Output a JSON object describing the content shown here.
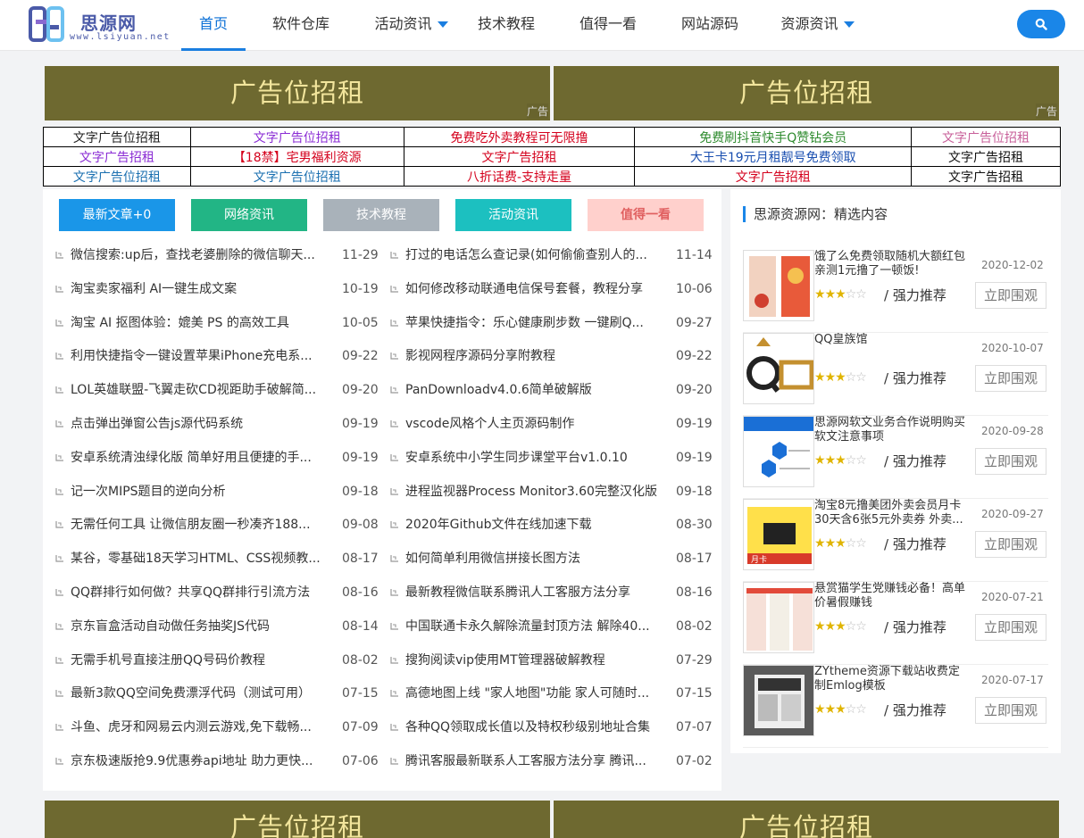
{
  "header": {
    "logo_title": "思源网",
    "logo_url": "www.lsiyuan.net",
    "nav": [
      {
        "label": "首页",
        "active": true,
        "dropdown": false
      },
      {
        "label": "软件仓库",
        "active": false,
        "dropdown": false
      },
      {
        "label": "活动资讯",
        "active": false,
        "dropdown": true
      },
      {
        "label": "技术教程",
        "active": false,
        "dropdown": false
      },
      {
        "label": "值得一看",
        "active": false,
        "dropdown": false
      },
      {
        "label": "网站源码",
        "active": false,
        "dropdown": false
      },
      {
        "label": "资源资讯",
        "active": false,
        "dropdown": true
      }
    ],
    "search_icon": "search-icon"
  },
  "ads": {
    "banner_text": "广告位招租",
    "banner_tag": "广告",
    "banner_color": "#6e6930",
    "text_ads": [
      [
        {
          "text": "文字广告位招租",
          "color": "#222222"
        },
        {
          "text": "文字广告位招租",
          "color": "#8a2bd4"
        },
        {
          "text": "免费吃外卖教程可无限撸",
          "color": "#d4001c"
        },
        {
          "text": "免费刷抖音快手Q赞钻会员",
          "color": "#2e8b2e"
        },
        {
          "text": "文字广告位招租",
          "color": "#c8609a"
        }
      ],
      [
        {
          "text": "文字广告招租",
          "color": "#8a2bd4"
        },
        {
          "text": "【18禁】宅男福利资源",
          "color": "#d4001c"
        },
        {
          "text": "文字广告招租",
          "color": "#d4001c"
        },
        {
          "text": "大王卡19元月租靓号免费领取",
          "color": "#1a4fb0"
        },
        {
          "text": "文字广告招租",
          "color": "#111111"
        }
      ],
      [
        {
          "text": "文字广告位招租",
          "color": "#1a6fb0"
        },
        {
          "text": "文字广告位招租",
          "color": "#1a6fb0"
        },
        {
          "text": "八折话费-支持走量",
          "color": "#d4001c"
        },
        {
          "text": "文字广告招租",
          "color": "#d4001c"
        },
        {
          "text": "文字广告招租",
          "color": "#111111"
        }
      ]
    ]
  },
  "main": {
    "tabs": [
      {
        "label": "最新文章+0",
        "color": "#1a96e8"
      },
      {
        "label": "网络资讯",
        "color": "#22b585"
      },
      {
        "label": "技术教程",
        "color": "#a9b2ba"
      },
      {
        "label": "活动资讯",
        "color": "#1cc0c0"
      },
      {
        "label": "值得一看",
        "color": "#ffd0cc"
      }
    ],
    "left_posts": [
      {
        "title": "微信搜索:up后，查找老婆删除的微信聊天...",
        "date": "11-29"
      },
      {
        "title": "淘宝卖家福利 AI一键生成文案",
        "date": "10-19"
      },
      {
        "title": "淘宝 AI 抠图体验：媲美 PS 的高效工具",
        "date": "10-05"
      },
      {
        "title": "利用快捷指令一键设置苹果iPhone充电系...",
        "date": "09-22"
      },
      {
        "title": "LOL英雄联盟-飞翼走砍CD视距助手破解简...",
        "date": "09-20"
      },
      {
        "title": "点击弹出弹窗公告js源代码系统",
        "date": "09-19"
      },
      {
        "title": "安卓系统清浊绿化版 简单好用且便捷的手...",
        "date": "09-19"
      },
      {
        "title": "记一次MIPS题目的逆向分析",
        "date": "09-18"
      },
      {
        "title": "无需任何工具 让微信朋友圈一秒凑齐188...",
        "date": "09-08"
      },
      {
        "title": "某谷，零基础18天学习HTML、CSS视频教...",
        "date": "08-17"
      },
      {
        "title": "QQ群排行如何做？共享QQ群排行引流方法",
        "date": "08-16"
      },
      {
        "title": "京东盲盒活动自动做任务抽奖JS代码",
        "date": "08-14"
      },
      {
        "title": "无需手机号直接注册QQ号码价教程",
        "date": "08-02"
      },
      {
        "title": "最新3款QQ空间免费漂浮代码（测试可用）",
        "date": "07-15"
      },
      {
        "title": "斗鱼、虎牙和网易云内测云游戏,免下载畅...",
        "date": "07-09"
      },
      {
        "title": "京东极速版抢9.9优惠券api地址 助力更快...",
        "date": "07-06"
      }
    ],
    "right_posts": [
      {
        "title": "打过的电话怎么查记录(如何偷偷查别人的...",
        "date": "11-14"
      },
      {
        "title": "如何修改移动联通电信保号套餐，教程分享",
        "date": "10-06"
      },
      {
        "title": "苹果快捷指令：乐心健康刷步数 一键刷Q...",
        "date": "09-27"
      },
      {
        "title": "影视网程序源码分享附教程",
        "date": "09-22"
      },
      {
        "title": "PanDownloadv4.0.6简单破解版",
        "date": "09-20"
      },
      {
        "title": "vscode风格个人主页源码制作",
        "date": "09-19"
      },
      {
        "title": "安卓系统中小学生同步课堂平台v1.0.10",
        "date": "09-19"
      },
      {
        "title": "进程监视器Process Monitor3.60完整汉化版",
        "date": "09-18"
      },
      {
        "title": "2020年Github文件在线加速下载",
        "date": "08-30"
      },
      {
        "title": "如何简单利用微信拼接长图方法",
        "date": "08-17"
      },
      {
        "title": "最新教程微信联系腾讯人工客服方法分享",
        "date": "08-16"
      },
      {
        "title": "中国联通卡永久解除流量封顶方法 解除40...",
        "date": "08-02"
      },
      {
        "title": "搜狗阅读vip使用MT管理器破解教程",
        "date": "07-29"
      },
      {
        "title": "高德地图上线 \"家人地图\"功能 家人可随时...",
        "date": "07-15"
      },
      {
        "title": "各种QQ领取成长值以及特权秒级别地址合集",
        "date": "07-07"
      },
      {
        "title": "腾讯客服最新联系人工客服方法分享 腾讯...",
        "date": "07-02"
      }
    ]
  },
  "sidebar": {
    "title": "思源资源网：精选内容",
    "recommend_label": "/ 强力推荐",
    "view_label": "立即围观",
    "items": [
      {
        "title": "饿了么免费领取随机大额红包 亲测1元撸了一顿饭!",
        "date": "2020-12-02",
        "rating": 3,
        "thumb": "food-thumb"
      },
      {
        "title": "QQ皇族馆",
        "date": "2020-10-07",
        "rating": 3,
        "thumb": "qq-logo-thumb"
      },
      {
        "title": "思源网软文业务合作说明购买软文注意事项",
        "date": "2020-09-28",
        "rating": 3,
        "thumb": "article-thumb"
      },
      {
        "title": "淘宝8元撸美团外卖会员月卡30天含6张5元外卖券 外卖...",
        "date": "2020-09-27",
        "rating": 3,
        "thumb": "meituan-card-thumb"
      },
      {
        "title": "悬赏猫学生党赚钱必备！高单价暑假赚钱",
        "date": "2020-07-21",
        "rating": 3,
        "thumb": "app-screens-thumb"
      },
      {
        "title": "ZYtheme资源下载站收费定制Emlog模板",
        "date": "2020-07-17",
        "rating": 3,
        "thumb": "theme-thumb"
      }
    ]
  }
}
